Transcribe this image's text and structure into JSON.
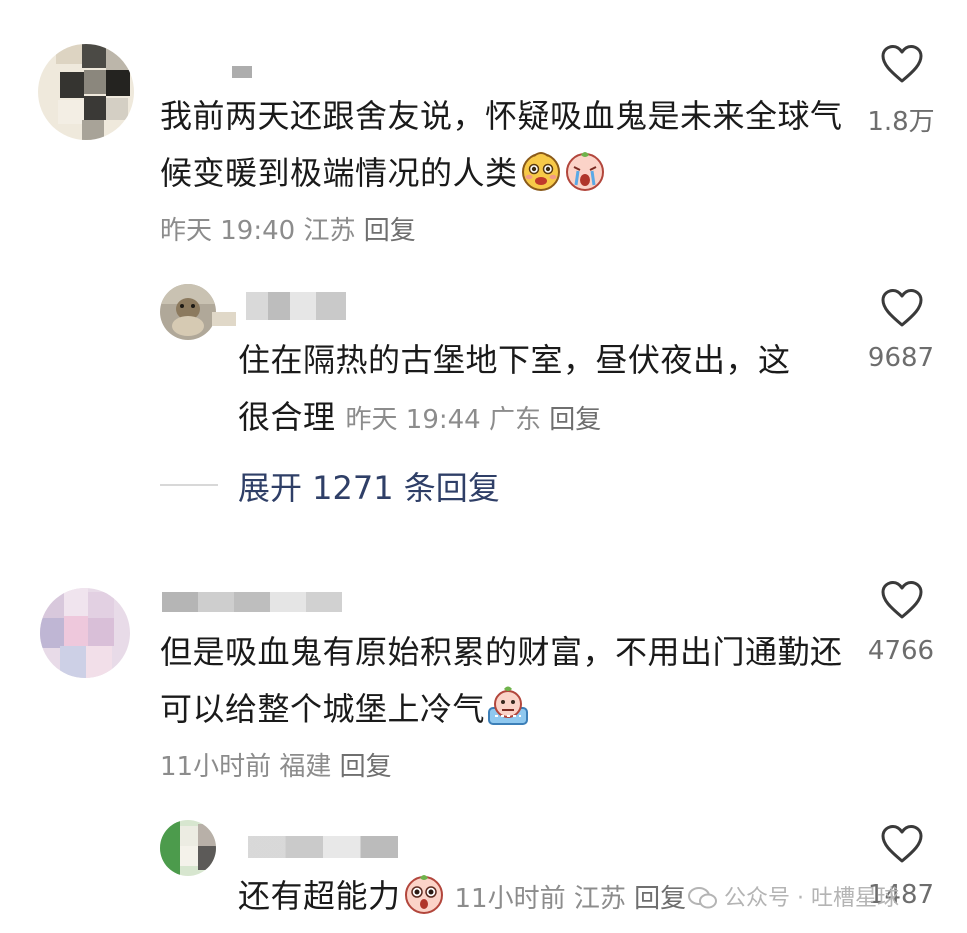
{
  "comments": [
    {
      "text": "我前两天还跟舍友说，怀疑吸血鬼是未来全球气候变暖到极端情况的人类",
      "time": "昨天 19:40",
      "location": "江苏",
      "reply": "回复",
      "likes": "1.8万",
      "emojis": [
        "drooling-emoji",
        "crying-emoji"
      ]
    },
    {
      "text": "住在隔热的古堡地下室，昼伏夜出，这很合理",
      "time": "昨天 19:44",
      "location": "广东",
      "reply": "回复",
      "likes": "9687"
    },
    {
      "text": "但是吸血鬼有原始积累的财富，不用出门通勤还可以给整个城堡上冷气",
      "time": "11小时前",
      "location": "福建",
      "reply": "回复",
      "likes": "4766",
      "emojis": [
        "cold-emoji"
      ]
    },
    {
      "text": "还有超能力",
      "time": "11小时前",
      "location": "江苏",
      "reply": "回复",
      "likes": "1487",
      "emojis": [
        "shocked-emoji"
      ]
    }
  ],
  "expand": {
    "label": "展开 1271 条回复"
  },
  "watermark": "公众号 · 吐槽星球",
  "colors": {
    "text": "#1a1a1a",
    "meta": "#8c8c8c",
    "expand": "#2f3f67",
    "heart": "#3a3a3a"
  }
}
